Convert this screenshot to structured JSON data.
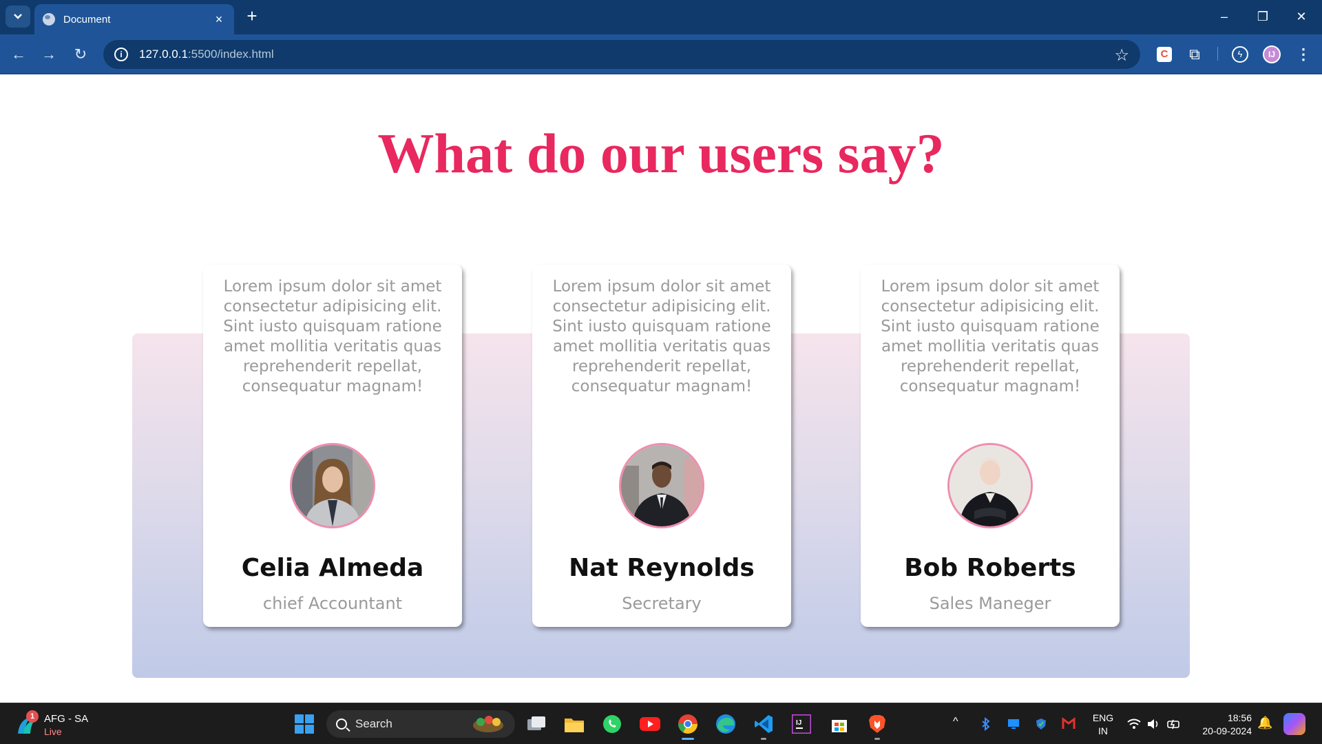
{
  "browser": {
    "tab": {
      "title": "Document",
      "close": "×"
    },
    "new_tab": "+",
    "window": {
      "minimize": "–",
      "restore": "❐",
      "close": "✕"
    },
    "nav": {
      "back": "←",
      "forward": "→",
      "reload": "↻"
    },
    "url_host": "127.0.0.1",
    "url_rest": ":5500/index.html",
    "bookmark": "☆",
    "extensions": {
      "c_ext": "C",
      "puzzle": "⧉",
      "bolt": "ϟ",
      "profile": "IJ",
      "menu": "⋮"
    }
  },
  "page": {
    "heading": "What do our users say?",
    "testimonials": [
      {
        "quote": "Lorem ipsum dolor sit amet consectetur adipisicing elit. Sint iusto quisquam ratione amet mollitia veritatis quas reprehenderit repellat, consequatur magnam!",
        "name": "Celia Almeda",
        "role": "chief Accountant"
      },
      {
        "quote": "Lorem ipsum dolor sit amet consectetur adipisicing elit. Sint iusto quisquam ratione amet mollitia veritatis quas reprehenderit repellat, consequatur magnam!",
        "name": "Nat Reynolds",
        "role": "Secretary"
      },
      {
        "quote": "Lorem ipsum dolor sit amet consectetur adipisicing elit. Sint iusto quisquam ratione amet mollitia veritatis quas reprehenderit repellat, consequatur magnam!",
        "name": "Bob Roberts",
        "role": "Sales Maneger"
      }
    ],
    "colors": {
      "heading": "#e8285e",
      "photo_border": "#ee8eae"
    }
  },
  "taskbar": {
    "weather": {
      "badge": "1",
      "title": "AFG - SA",
      "status": "Live"
    },
    "search_placeholder": "Search",
    "tray_chevron": "^",
    "language": {
      "line1": "ENG",
      "line2": "IN"
    },
    "clock": {
      "time": "18:56",
      "date": "20-09-2024"
    }
  }
}
